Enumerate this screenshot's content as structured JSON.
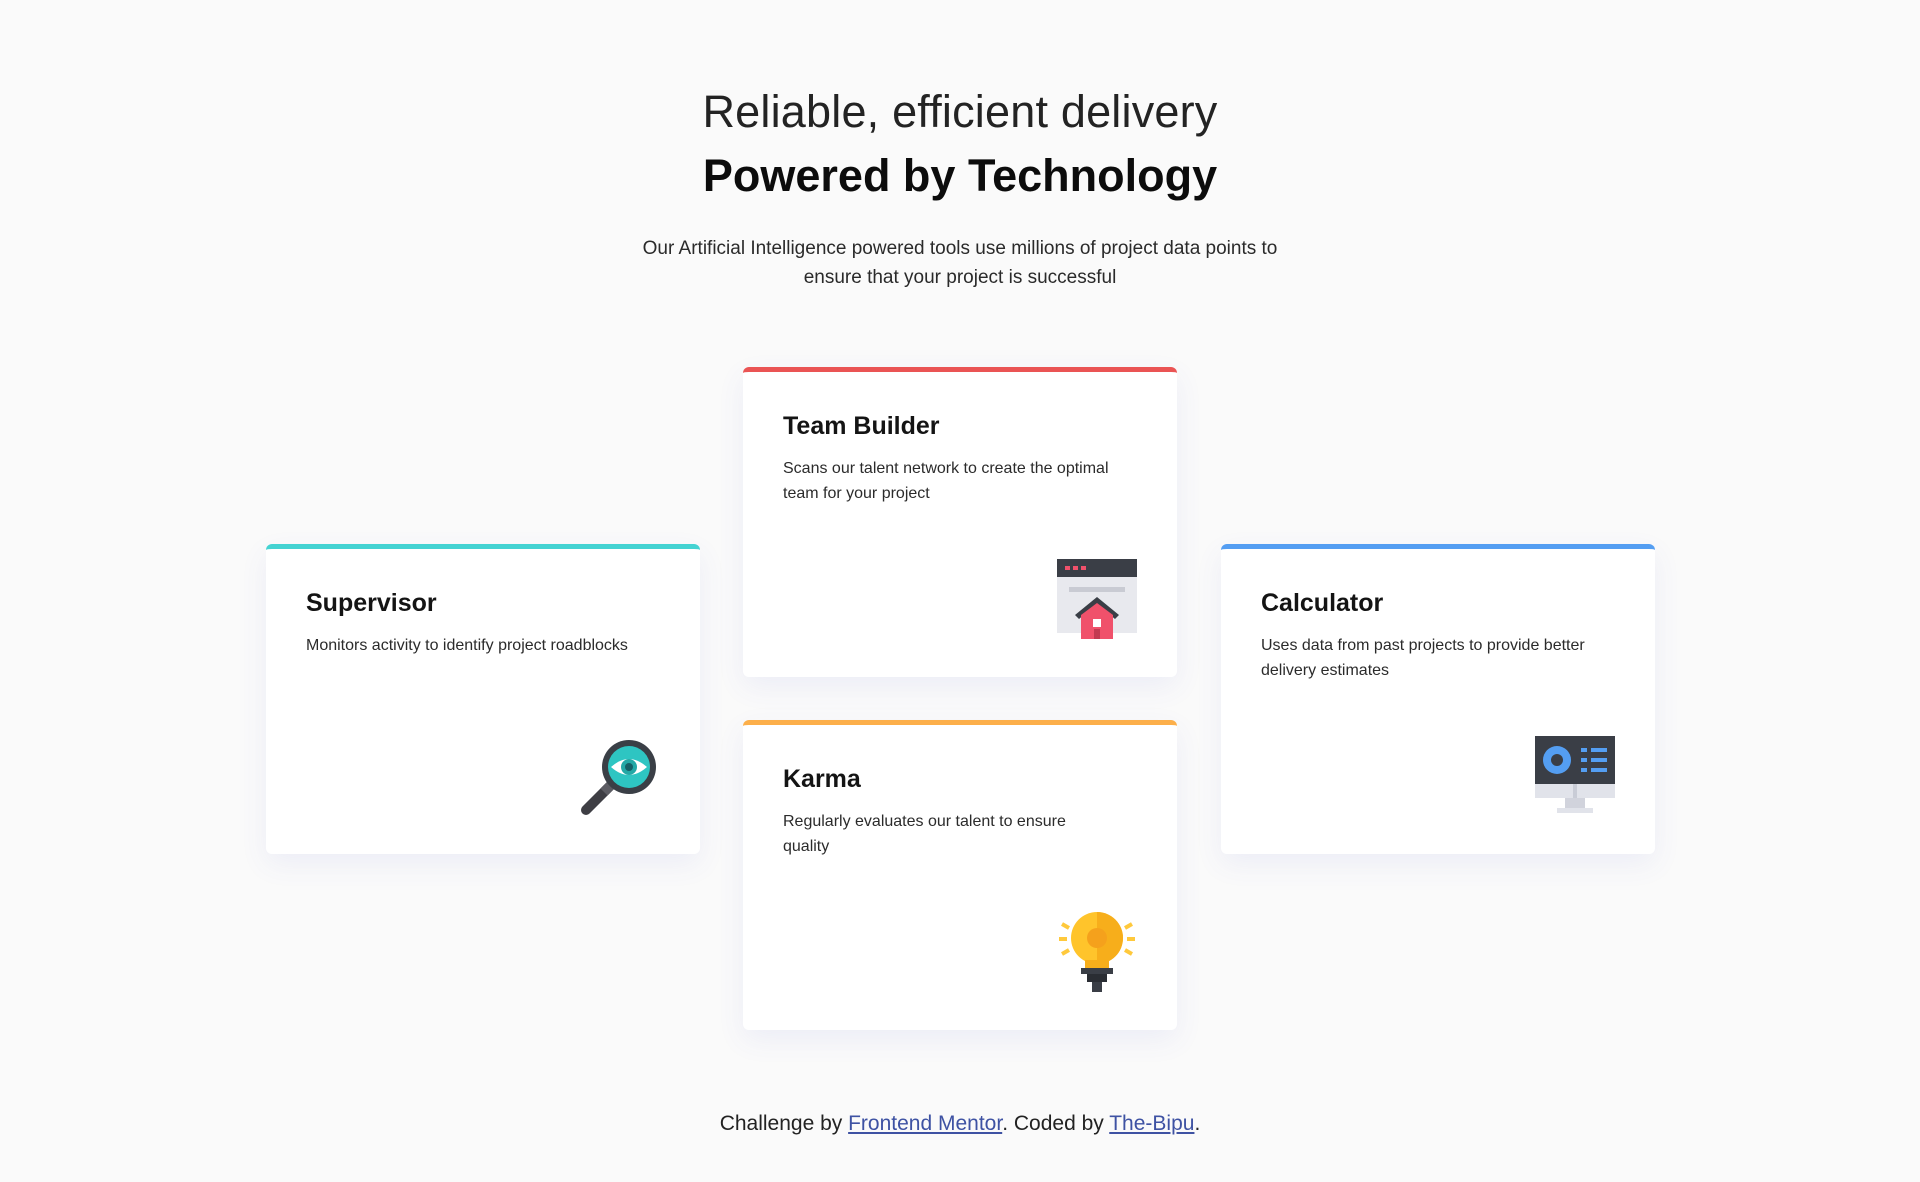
{
  "header": {
    "subtitle": "Reliable, efficient delivery",
    "title": "Powered by Technology",
    "description": "Our Artificial Intelligence powered tools use millions of project data points to ensure that your project is successful"
  },
  "cards": [
    {
      "title": "Supervisor",
      "description": "Monitors activity to identify project roadblocks",
      "accent": "#44d3d2",
      "icon": "magnifier-eye-icon"
    },
    {
      "title": "Team Builder",
      "description": "Scans our talent network to create the optimal team for your project",
      "accent": "#ea5454",
      "icon": "browser-house-icon"
    },
    {
      "title": "Karma",
      "description": "Regularly evaluates our talent to ensure quality",
      "accent": "#fcaf4a",
      "icon": "lightbulb-icon"
    },
    {
      "title": "Calculator",
      "description": "Uses data from past projects to provide better delivery estimates",
      "accent": "#549ef2",
      "icon": "monitor-icon"
    }
  ],
  "attribution": {
    "prefix": "Challenge by ",
    "link1": "Frontend Mentor",
    "middle": ". Coded by ",
    "link2": "The-Bipu",
    "suffix": "."
  }
}
